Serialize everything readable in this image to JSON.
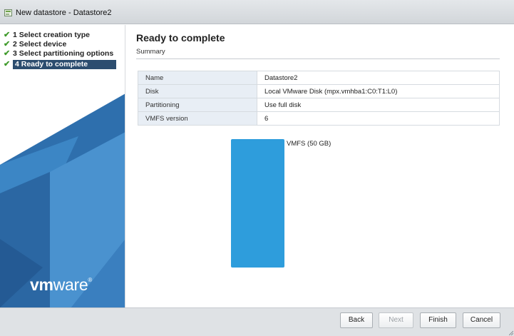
{
  "window": {
    "title": "New datastore - Datastore2"
  },
  "steps": [
    {
      "label": "1 Select creation type",
      "done": true
    },
    {
      "label": "2 Select device",
      "done": true
    },
    {
      "label": "3 Select partitioning options",
      "done": true
    },
    {
      "label": "4 Ready to complete",
      "done": true,
      "active": true
    }
  ],
  "brand": {
    "logo_bold": "vm",
    "logo_rest": "ware",
    "logo_mark": "®"
  },
  "page": {
    "title": "Ready to complete",
    "subtitle": "Summary"
  },
  "summary": [
    {
      "key": "Name",
      "value": "Datastore2"
    },
    {
      "key": "Disk",
      "value": "Local VMware Disk (mpx.vmhba1:C0:T1:L0)"
    },
    {
      "key": "Partitioning",
      "value": "Use full disk"
    },
    {
      "key": "VMFS version",
      "value": "6"
    }
  ],
  "partition": {
    "label": "VMFS  (50 GB)",
    "color": "#2e9ddc"
  },
  "buttons": {
    "back": "Back",
    "next": "Next",
    "finish": "Finish",
    "cancel": "Cancel"
  },
  "colors": {
    "active_step_bg": "#2c4d6f",
    "check": "#3f9a2b",
    "table_key_bg": "#e8eef5"
  }
}
